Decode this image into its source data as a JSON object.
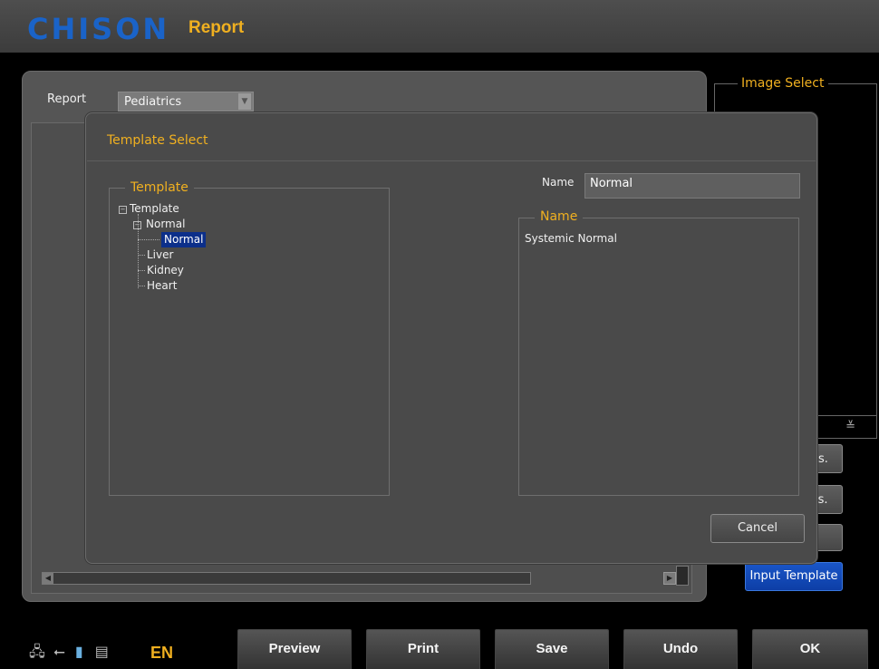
{
  "app": {
    "brand": "CHISON",
    "title": "Report"
  },
  "report": {
    "label": "Report",
    "selected": "Pediatrics"
  },
  "image_select": {
    "title": "Image Select",
    "nav_icon": "chevron-double-down-icon"
  },
  "side_buttons": {
    "input_template": "Input Template",
    "btn1_partial": "s.",
    "btn2_partial": "ıs."
  },
  "template_dialog": {
    "title": "Template Select",
    "template_legend": "Template",
    "tree": {
      "root": "Template",
      "normal_group": "Normal",
      "normal_child": "Normal",
      "items": [
        "Liver",
        "Kidney",
        "Heart"
      ]
    },
    "name_label": "Name",
    "name_value": "Normal",
    "name_legend": "Name",
    "description": "Systemic Normal",
    "cancel": "Cancel"
  },
  "status": {
    "language": "EN"
  },
  "bottom_buttons": [
    "Preview",
    "Print",
    "Save",
    "Undo",
    "OK"
  ]
}
